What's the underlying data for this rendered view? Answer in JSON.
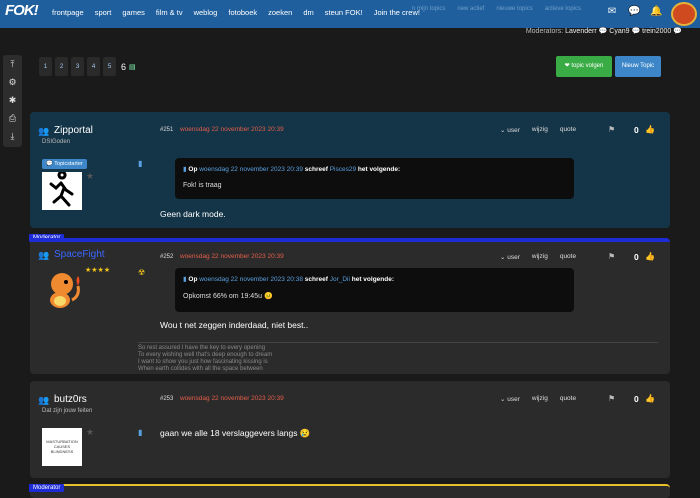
{
  "topbar": {
    "logo": "FOK!",
    "nav": [
      "frontpage",
      "sport",
      "games",
      "film & tv",
      "weblog",
      "fotoboek",
      "zoeken",
      "dm",
      "steun FOK!",
      "Join the crew!"
    ],
    "ghost_nav": [
      "n mijn topics",
      "new actief",
      "nieuwe topics",
      "actieve topics"
    ],
    "icons": [
      "mail-icon",
      "chat-icon",
      "bell-icon"
    ]
  },
  "sidebar": [
    "arrow-up-icon",
    "gear-icon",
    "settings-icon",
    "print-icon",
    "download-icon"
  ],
  "moderators": {
    "label": "Moderators:",
    "names": [
      "Lavenderr",
      "Cyan9",
      "trein2000"
    ]
  },
  "pager": {
    "pages": [
      "1",
      "2",
      "3",
      "4",
      "5"
    ],
    "current": "6"
  },
  "buttons": {
    "follow": "topic volgen",
    "new_topic": "Nieuw Topic"
  },
  "actions": {
    "user": "user",
    "quote_edit": "wijzig",
    "quote": "quote"
  },
  "posts": [
    {
      "user": "Zipportal",
      "title": "DSIGoden",
      "badge": "Topicstarter",
      "num": "#251",
      "date": "woensdag 22 november 2023  20:39",
      "score": "0",
      "quote_op": "Op",
      "quote_date": "woensdag 22 november 2023 20:39",
      "quote_wrote": "schreef",
      "quote_user": "Pisces29",
      "quote_tail": "het volgende:",
      "quote_text": "Fok! is traag",
      "message": "Geen dark mode."
    },
    {
      "modtag": "Moderator",
      "user": "SpaceFight",
      "num": "#252",
      "date": "woensdag 22 november 2023  20:39",
      "score": "0",
      "quote_op": "Op",
      "quote_date": "woensdag 22 november 2023 20:38",
      "quote_wrote": "schreef",
      "quote_user": "Jor_Dii",
      "quote_tail": "het volgende:",
      "quote_text": "Opkomst 66% om 19:45u",
      "message": "Wou t net zeggen inderdaad, niet best..",
      "signature": [
        "So rest assured I have the key to every opening",
        "To every wishing well that's deep enough to dream",
        "I want to show you just how fascinating kissing is",
        "When earth collides with all the space between"
      ]
    },
    {
      "user": "butz0rs",
      "title": "Dat zijn jouw feiten",
      "pic_text": "MASTURBATION CAUSES BLINDNESS",
      "num": "#253",
      "date": "woensdag 22 november 2023  20:39",
      "score": "0",
      "message": "gaan we alle 18 verslaggevers langs"
    },
    {
      "modtag": "Moderator"
    }
  ]
}
